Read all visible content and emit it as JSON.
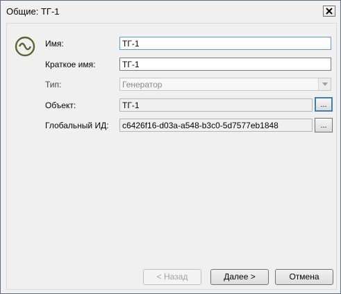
{
  "window": {
    "title": "Общие: ТГ-1"
  },
  "icon": {
    "name": "generator-icon",
    "color": "#5b6130"
  },
  "form": {
    "name_label": "Имя:",
    "name_value": "ТГ-1",
    "short_name_label": "Краткое имя:",
    "short_name_value": "ТГ-1",
    "type_label": "Тип:",
    "type_value": "Генератор",
    "object_label": "Объект:",
    "object_value": "ТГ-1",
    "object_button": "...",
    "global_id_label": "Глобальный ИД:",
    "global_id_value": "c6426f16-d03a-a548-b3c0-5d7577eb1848",
    "global_id_button": "..."
  },
  "buttons": {
    "back": "< Назад",
    "next": "Далее >",
    "cancel": "Отмена"
  }
}
